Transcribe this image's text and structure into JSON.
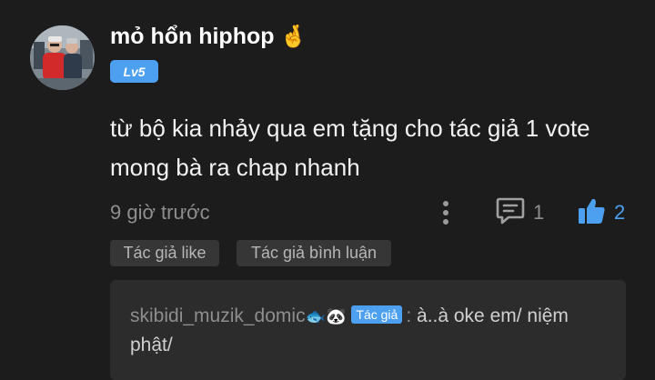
{
  "comment": {
    "username": "mỏ hổn hiphop",
    "username_emoji": "🤞",
    "level": "Lv5",
    "text": "từ bộ kia nhảy qua em tặng cho tác giả 1 vote mong bà ra chap nhanh",
    "time": "9 giờ trước",
    "reply_count": "1",
    "like_count": "2",
    "tags": [
      "Tác giả like",
      "Tác giả bình luận"
    ]
  },
  "reply": {
    "author": "skibidi_muzik_domic",
    "author_emojis": "🐟🐼",
    "badge": "Tác giả",
    "separator": ":",
    "text": "à..à oke em/ niệm phật/"
  },
  "colors": {
    "background": "#1c1c1c",
    "accent": "#4da0f0",
    "muted_text": "#8e8e8e",
    "tag_bg": "#363636",
    "reply_bg": "#2c2c2c"
  },
  "icons": {
    "more": "more-vertical-icon",
    "reply": "comment-icon",
    "like": "thumbs-up-icon"
  }
}
